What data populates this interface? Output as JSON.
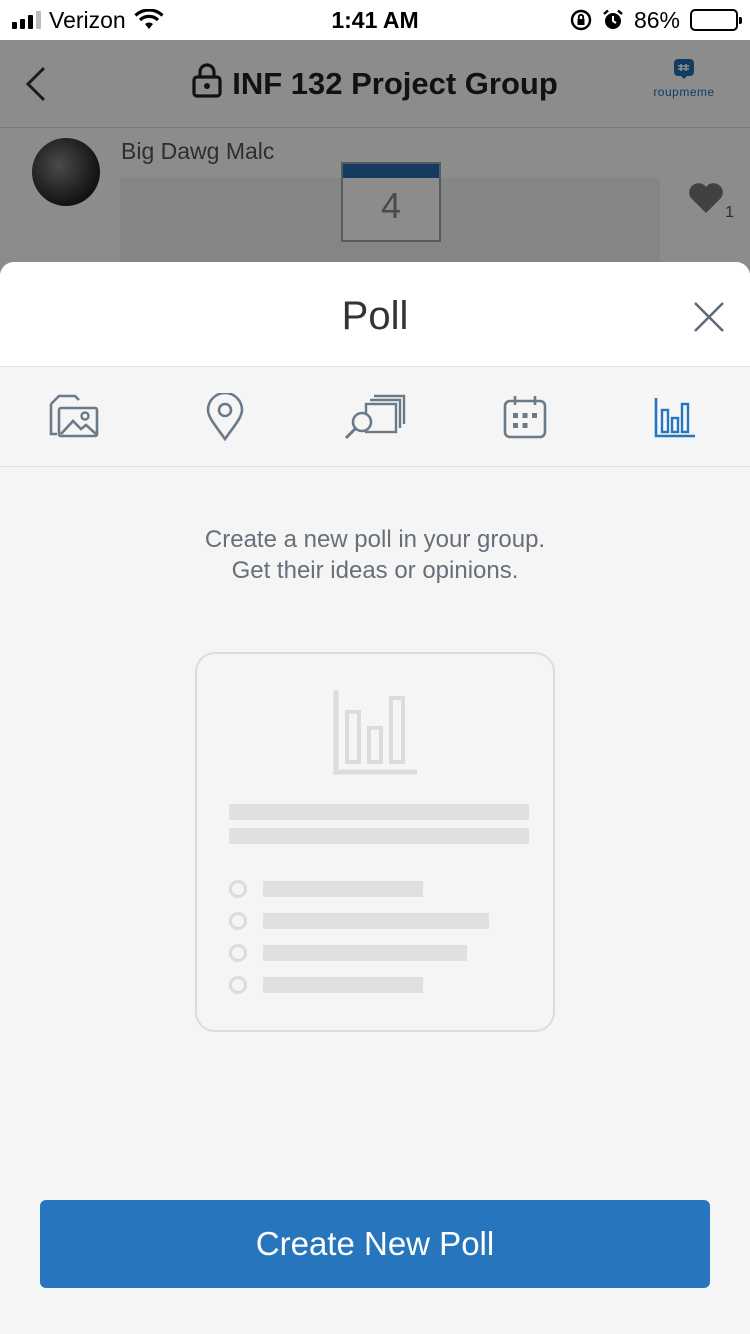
{
  "status_bar": {
    "carrier": "Verizon",
    "time": "1:41 AM",
    "battery_percent": "86%",
    "battery_level": 0.86
  },
  "background_chat": {
    "title": "INF 132 Project Group",
    "logo_text": "roupmeme",
    "message_author": "Big Dawg Malc",
    "calendar_day": "4",
    "like_count": "1"
  },
  "sheet": {
    "title": "Poll",
    "tabs": [
      {
        "icon": "gallery-icon",
        "active": false
      },
      {
        "icon": "location-pin-icon",
        "active": false
      },
      {
        "icon": "search-cards-icon",
        "active": false
      },
      {
        "icon": "calendar-icon",
        "active": false
      },
      {
        "icon": "poll-chart-icon",
        "active": true
      }
    ],
    "description_line1": "Create a new poll in your group.",
    "description_line2": "Get their ideas or opinions.",
    "create_button_label": "Create New Poll"
  },
  "colors": {
    "accent": "#2775bd",
    "tab_inactive": "#6b7a89",
    "text_muted": "#66707a",
    "placeholder": "#e0e0e0"
  }
}
